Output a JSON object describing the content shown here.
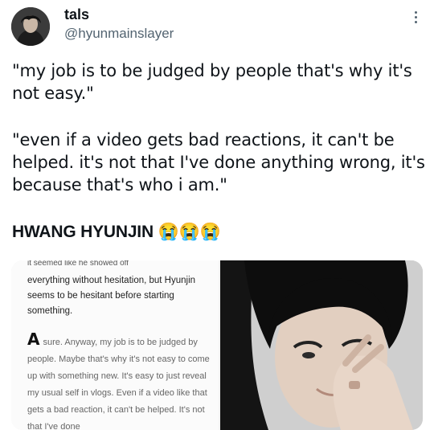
{
  "user": {
    "name": "tals",
    "handle": "@hyunmainslayer"
  },
  "tweet": {
    "paragraph1": "\"my job is to be judged by people that's why it's not easy.\"",
    "paragraph2": "\"even if a video gets bad reactions, it can't be helped. it's not that I've done anything wrong, it's because that's who i am.\"",
    "paragraph3": "HWANG HYUNJIN",
    "emojis": "😭😭😭"
  },
  "article": {
    "cutoff_line": "it seemed like he showed off",
    "question": "everything without hesitation, but Hyunjin seems to be hesitant before starting something.",
    "answer_letter": "A",
    "answer": "sure. Anyway, my job is to be judged by people. Maybe that's why it's not easy to come up with something new. It's easy to just reveal my usual self in vlogs. Even if a video like that gets a bad reaction, it can't be helped. It's not that I've done"
  },
  "colors": {
    "text": "#0f1419",
    "secondary": "#536471",
    "background": "#ffffff"
  },
  "icons": {
    "more": "more-vertical-icon",
    "avatar": "avatar"
  }
}
